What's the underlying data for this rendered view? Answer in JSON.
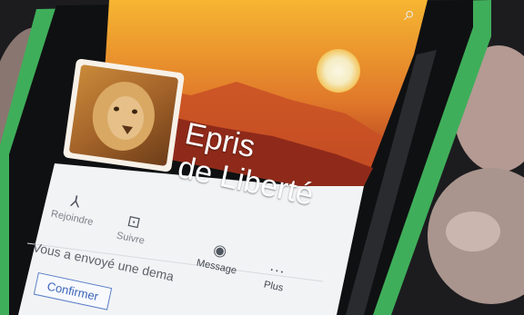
{
  "profile": {
    "name_line1": "Epris",
    "name_line2": "de Liberté"
  },
  "actions": [
    {
      "icon": "person-add-icon",
      "label": "Rejoindre",
      "glyph": "⅄"
    },
    {
      "icon": "follow-icon",
      "label": "Suivre",
      "glyph": "⊡"
    },
    {
      "icon": "messenger-icon",
      "label": "Message",
      "glyph": "◉"
    },
    {
      "icon": "more-icon",
      "label": "Plus",
      "glyph": "···"
    }
  ],
  "request": {
    "text": "Vous a envoyé une dema",
    "confirm_label": "Confirmer"
  },
  "toolbar": {
    "search_icon": "search-icon",
    "search_glyph": "⌕"
  },
  "colors": {
    "phone_frame": "#3fae5a",
    "sky_top": "#f2a12a",
    "sky_bottom": "#c2441f",
    "sun": "#f4f1d8"
  }
}
